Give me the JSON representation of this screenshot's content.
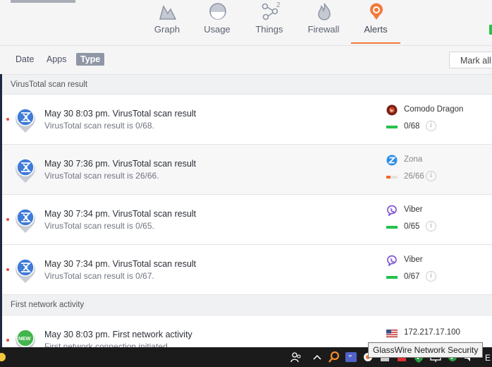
{
  "nav": {
    "tabs": [
      {
        "label": "Graph",
        "icon": "graph-icon"
      },
      {
        "label": "Usage",
        "icon": "usage-icon"
      },
      {
        "label": "Things",
        "icon": "things-icon",
        "badge": "2"
      },
      {
        "label": "Firewall",
        "icon": "firewall-icon"
      },
      {
        "label": "Alerts",
        "icon": "alerts-icon",
        "active": true
      }
    ]
  },
  "filters": {
    "items": [
      "Date",
      "Apps",
      "Type"
    ],
    "selected": "Type",
    "mark_all": "Mark all"
  },
  "sections": [
    {
      "header": "VirusTotal scan result",
      "rows": [
        {
          "title": "May 30 8:03 pm. VirusTotal scan result",
          "subtitle": "VirusTotal scan result is 0/68.",
          "app": "Comodo Dragon",
          "ratio": "0/68",
          "level": 0.0,
          "bar_color": "#24c24b",
          "unread": true
        },
        {
          "title": "May 30 7:36 pm. VirusTotal scan result",
          "subtitle": "VirusTotal scan result is 26/66.",
          "app": "Zona",
          "ratio": "26/66",
          "level": 0.39,
          "bar_color": "#f26a28",
          "unread": false
        },
        {
          "title": "May 30 7:34 pm. VirusTotal scan result",
          "subtitle": "VirusTotal scan result is 0/65.",
          "app": "Viber",
          "ratio": "0/65",
          "level": 0.0,
          "bar_color": "#24c24b",
          "unread": true
        },
        {
          "title": "May 30 7:34 pm. VirusTotal scan result",
          "subtitle": "VirusTotal scan result is 0/67.",
          "app": "Viber",
          "ratio": "0/67",
          "level": 0.0,
          "bar_color": "#24c24b",
          "unread": true
        }
      ]
    },
    {
      "header": "First network activity",
      "rows": [
        {
          "title": "May 30 8:03 pm. First network activity",
          "subtitle": "First network connection initiated",
          "badge": "NEW",
          "app": "172.217.17.100",
          "unread": true
        }
      ]
    }
  ],
  "taskbar": {
    "tooltip": "GlassWire Network Security",
    "edge_text": "E"
  },
  "colors": {
    "accent": "#f17a3a",
    "pin_blue": "#3f7bd9",
    "pin_green": "#43b54c",
    "ok_green": "#24c24b",
    "warn_orange": "#f26a28"
  }
}
